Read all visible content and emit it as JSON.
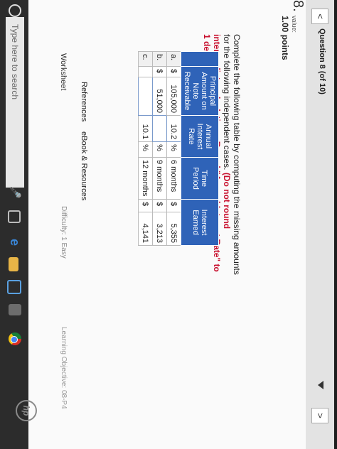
{
  "nav": {
    "prev": "<",
    "next": ">",
    "title": "Question 8 (of 10)"
  },
  "question": {
    "number": "8.",
    "value_label": "value:",
    "points": "1.00 points",
    "instruction_plain": "Complete the following table by computing the missing amounts for the following independent cases.",
    "instruction_red": "(Do not round intermediate calculations. Round \"Annual Interest Rate\" to 1 decimal place.)"
  },
  "table": {
    "headers": [
      "Principal Amount on Note Receivable",
      "Annual Interest Rate",
      "Time Period",
      "Interest Earned"
    ],
    "rows": [
      {
        "case": "a.",
        "principal_sym": "$",
        "principal": "105,000",
        "rate": "10.2",
        "rate_unit": "%",
        "time": "6 months",
        "interest_sym": "$",
        "interest": "5,355"
      },
      {
        "case": "b.",
        "principal_sym": "$",
        "principal": "51,000",
        "rate": "",
        "rate_unit": "%",
        "time": "9 months",
        "interest_sym": "$",
        "interest": "3,213"
      },
      {
        "case": "c.",
        "principal_sym": "",
        "principal": "",
        "rate": "10.1",
        "rate_unit": "%",
        "time": "12 months",
        "interest_sym": "$",
        "interest": "4,141"
      }
    ]
  },
  "footer": {
    "references": "References",
    "ebook": "eBook & Resources",
    "worksheet": "Worksheet",
    "difficulty": "Difficulty: 1 Easy",
    "learning": "Learning Objective: 08-P4"
  },
  "taskbar": {
    "search_placeholder": "Type here to search"
  },
  "device": {
    "logo": "hp"
  },
  "colors": {
    "header_blue": "#2f63b8",
    "instruction_red": "#c8102e",
    "taskbar": "#2c2c2c"
  }
}
